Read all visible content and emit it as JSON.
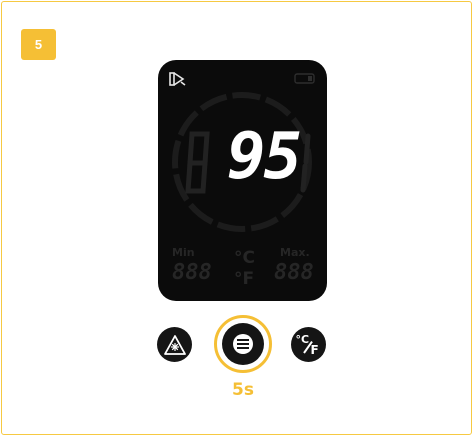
{
  "step": {
    "number": "5"
  },
  "display": {
    "reading": "95",
    "ghost_digit": "8",
    "min_label": "Min",
    "max_label": "Max.",
    "unit_c": "°C",
    "unit_f": "°F",
    "min_value": "888",
    "max_value": "888"
  },
  "buttons": {
    "laser_icon": "laser-icon",
    "menu_icon": "menu-icon",
    "unit_icon": "celsius-fahrenheit-icon",
    "unit_c_glyph": "°C",
    "unit_f_glyph": "F"
  },
  "hold": {
    "label": "5s"
  },
  "colors": {
    "accent": "#f5bf35",
    "device": "#0b0b0b",
    "lcd_dim": "#262626",
    "lcd_on": "#ffffff"
  }
}
